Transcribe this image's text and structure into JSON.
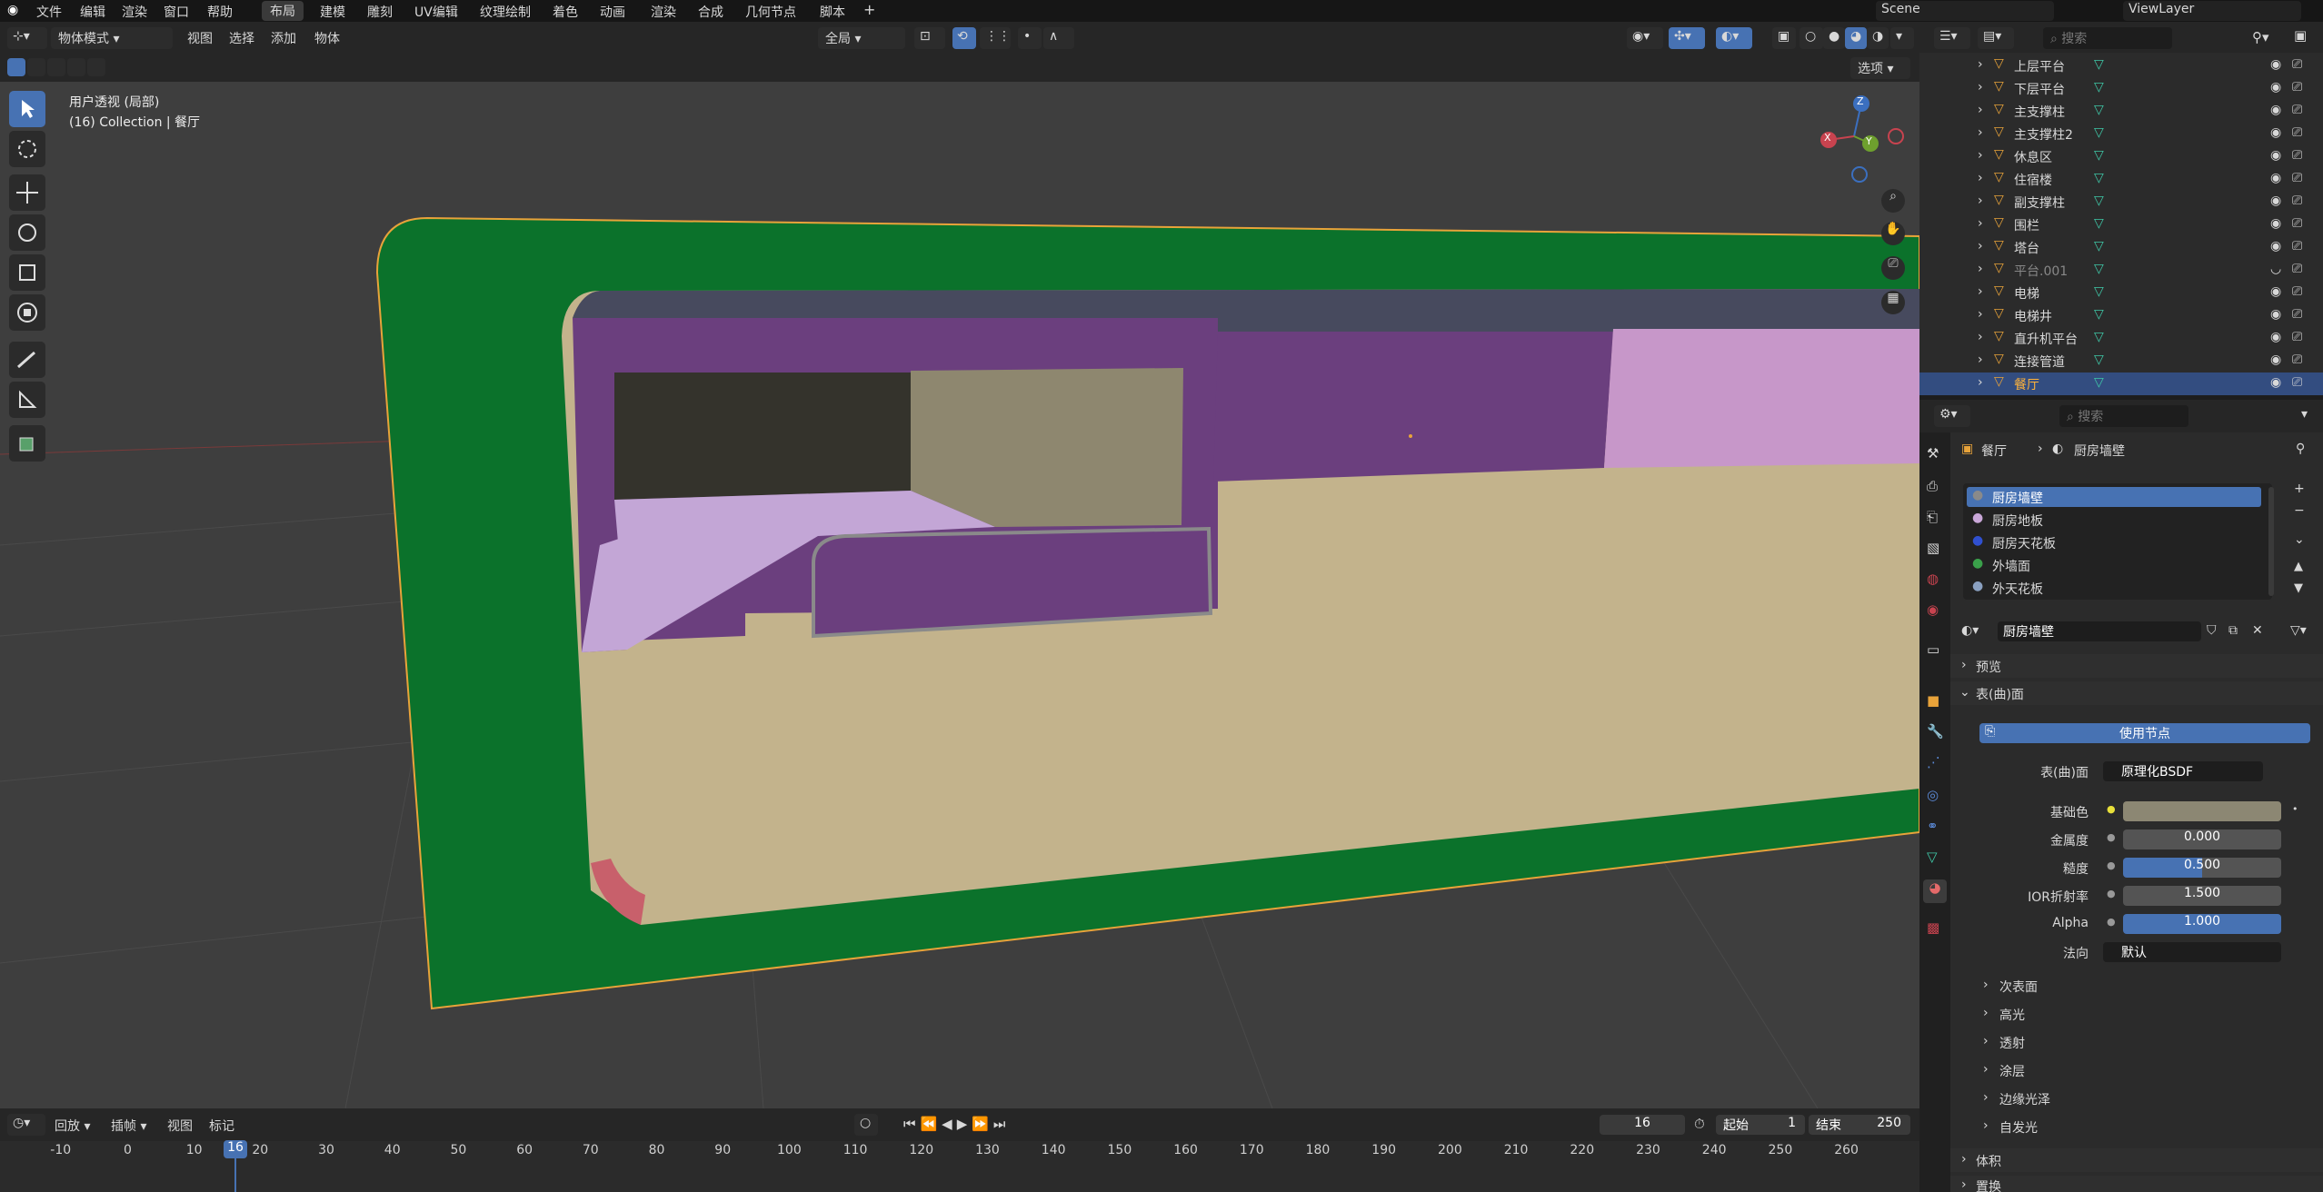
{
  "menu": {
    "file": "文件",
    "edit": "编辑",
    "render": "渲染",
    "window": "窗口",
    "help": "帮助"
  },
  "workspaces": [
    "布局",
    "建模",
    "雕刻",
    "UV编辑",
    "纹理绘制",
    "着色",
    "动画",
    "渲染",
    "合成",
    "几何节点",
    "脚本"
  ],
  "add_tab": "+",
  "scene": "Scene",
  "view_layer": "ViewLayer",
  "viewport_header": {
    "mode": "物体模式",
    "view": "视图",
    "select": "选择",
    "add": "添加",
    "object": "物体",
    "orientation": "全局",
    "options": "选项"
  },
  "viewport_overlay": {
    "line1": "用户透视 (局部)",
    "line2": "(16) Collection | 餐厅"
  },
  "gizmo": {
    "x": "X",
    "y": "Y",
    "z": "Z"
  },
  "outliner": {
    "search_placeholder": "搜索",
    "items": [
      "上层平台",
      "下层平台",
      "主支撑柱",
      "主支撑柱2",
      "休息区",
      "住宿楼",
      "副支撑柱",
      "围栏",
      "塔台",
      "平台.001",
      "电梯",
      "电梯井",
      "直升机平台",
      "连接管道",
      "餐厅"
    ],
    "active": "餐厅",
    "dimmed": "平台.001"
  },
  "properties": {
    "search_placeholder": "搜索",
    "breadcrumb_object": "餐厅",
    "breadcrumb_material": "厨房墙壁",
    "slots": [
      "厨房墙壁",
      "厨房地板",
      "厨房天花板",
      "外墙面",
      "外天花板"
    ],
    "slot_colors": [
      "#8a8a8a",
      "#c9a7d8",
      "#3050d0",
      "#3aa04a",
      "#8aa0c0"
    ],
    "material_name": "厨房墙壁",
    "preview": "预览",
    "surface_panel": "表(曲)面",
    "use_nodes": "使用节点",
    "surface_label": "表(曲)面",
    "surface_value": "原理化BSDF",
    "base_color_label": "基础色",
    "base_color": "#8c8773",
    "metallic_label": "金属度",
    "metallic": "0.000",
    "roughness_label": "糙度",
    "roughness": "0.500",
    "ior_label": "IOR折射率",
    "ior": "1.500",
    "alpha_label": "Alpha",
    "alpha": "1.000",
    "normal_label": "法向",
    "normal": "默认",
    "subsections": [
      "次表面",
      "高光",
      "透射",
      "涂层",
      "边缘光泽",
      "自发光"
    ],
    "volume": "体积",
    "displacement": "置换"
  },
  "timeline": {
    "playback": "回放",
    "keying": "插帧",
    "view": "视图",
    "marker": "标记",
    "current_frame": "16",
    "start_label": "起始",
    "start": "1",
    "end_label": "结束",
    "end": "250",
    "ticks": [
      "-10",
      "0",
      "10",
      "20",
      "30",
      "40",
      "50",
      "60",
      "70",
      "80",
      "90",
      "100",
      "110",
      "120",
      "130",
      "140",
      "150",
      "160",
      "170",
      "180",
      "190",
      "200",
      "210",
      "220",
      "230",
      "240",
      "250",
      "260"
    ],
    "playhead": "16"
  },
  "colors": {
    "accent": "#4772b3",
    "selected_outline": "#e8a33a",
    "green_frame": "#0b722b",
    "floor": "#c3b38c",
    "purple_wall": "#6b3f7e",
    "pink_wall": "#c797c9",
    "viewport_bg": "#3e3e3e"
  }
}
